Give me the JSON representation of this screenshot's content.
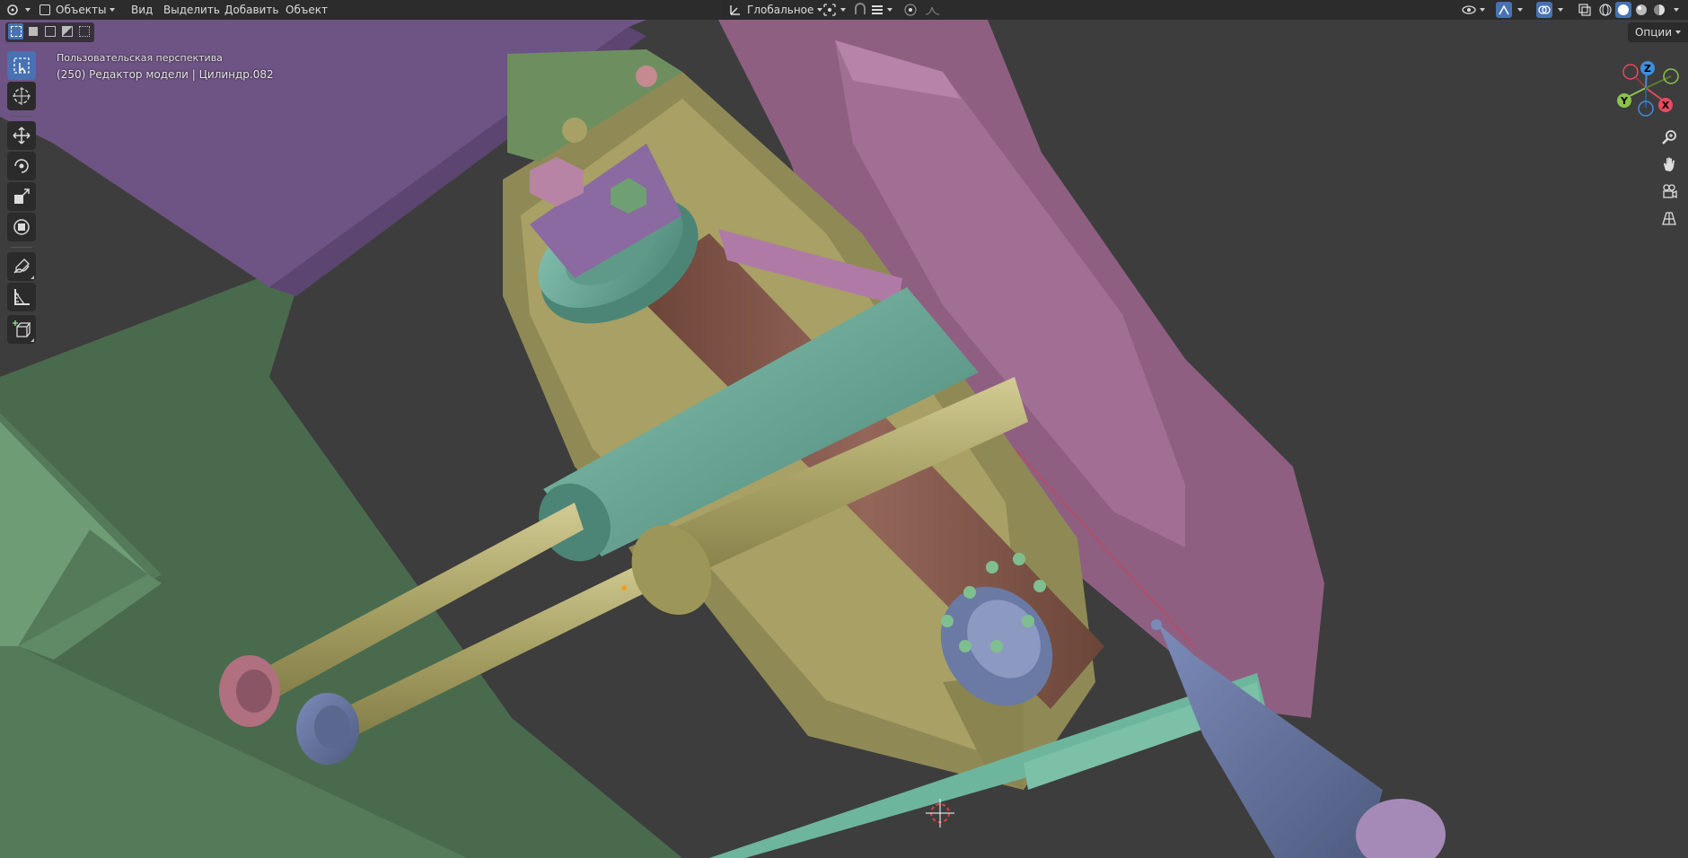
{
  "header": {
    "mode_label": "Объекты",
    "menu": [
      "Вид",
      "Выделить",
      "Добавить",
      "Объект"
    ],
    "transform_orientation": "Глобальное",
    "options_label": "Опции",
    "icons": [
      "editor-type-icon",
      "object-mode-icon",
      "select-mode-icons",
      "transform-orientation-icon",
      "pivot-icon",
      "snap-icon",
      "proportional-edit-icon",
      "visibility-icon",
      "gizmo-icon",
      "overlay-icon",
      "xray-icon",
      "shading-wireframe-icon",
      "shading-solid-icon",
      "shading-material-icon",
      "shading-rendered-icon"
    ]
  },
  "viewport": {
    "view_name": "Пользовательская перспектива",
    "object_info": "(250) Редактор модели | Цилиндр.082"
  },
  "toolbar": {
    "tools": [
      "select-box-icon",
      "cursor-icon",
      "move-icon",
      "rotate-icon",
      "scale-icon",
      "transform-icon",
      "annotate-icon",
      "measure-icon",
      "add-cube-icon"
    ],
    "active_tool": "select-box-icon"
  },
  "gizmo": {
    "axes": [
      "X",
      "Y",
      "Z"
    ],
    "colors": {
      "x": "#e84a5f",
      "y": "#8bc34a",
      "z": "#3f8fe0"
    }
  },
  "nav_icons": [
    "zoom-icon",
    "pan-hand-icon",
    "camera-view-icon",
    "ortho-grid-icon"
  ],
  "colors": {
    "background": "#3d3d3d",
    "header": "#282828",
    "accent": "#4772b3",
    "mesh_purple": "#6b4f80",
    "mesh_pink": "#a86e95",
    "mesh_green": "#4d6e50",
    "mesh_teal": "#5d9b8a",
    "mesh_olive": "#a8a065",
    "mesh_brown": "#7d5446",
    "mesh_blue": "#6a7aa4"
  }
}
